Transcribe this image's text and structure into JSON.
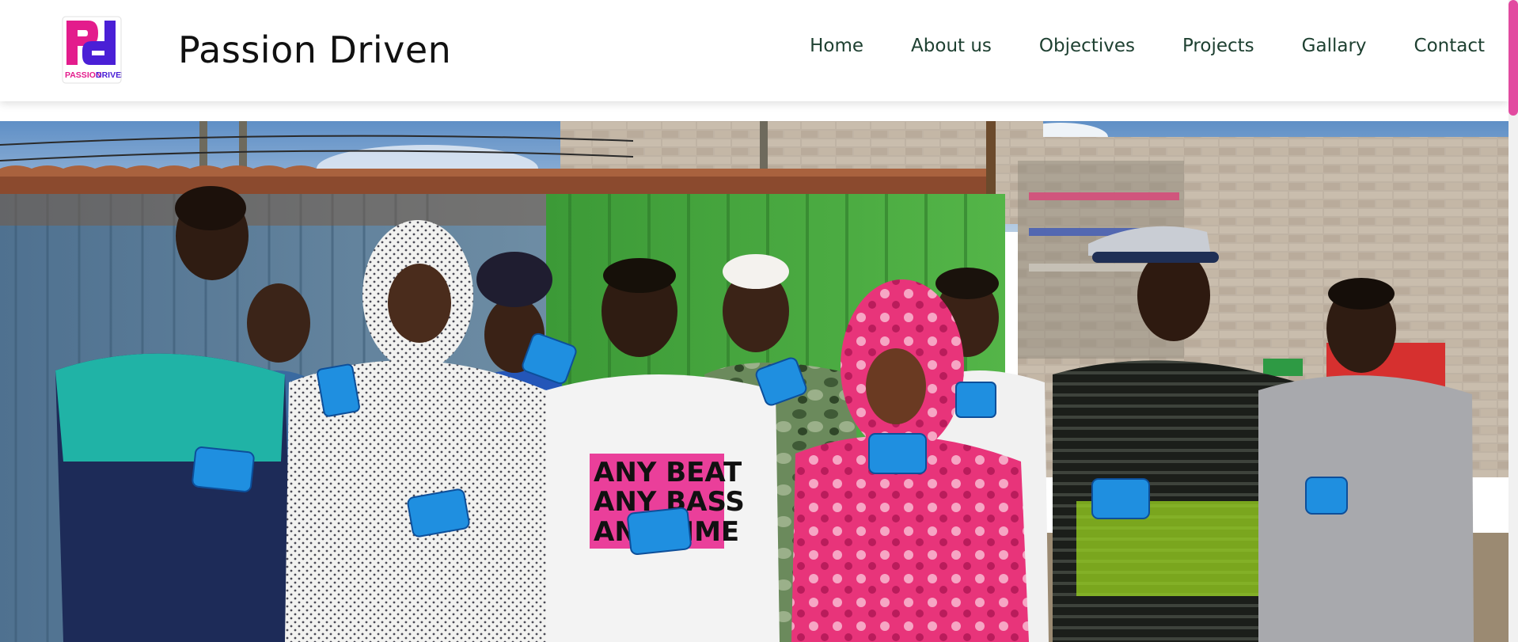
{
  "header": {
    "logo": {
      "text_left": "PASSION",
      "text_right": "DRIVEN",
      "icon": "pd-monogram-logo",
      "colors": {
        "pink": "#e31c8c",
        "purple": "#4a1fd6"
      }
    },
    "title": "Passion Driven",
    "nav": [
      {
        "label": "Home"
      },
      {
        "label": "About us"
      },
      {
        "label": "Objectives"
      },
      {
        "label": "Projects"
      },
      {
        "label": "Gallary"
      },
      {
        "label": "Contact"
      }
    ]
  },
  "hero": {
    "image": "group-photo-youth-holding-sanitary-pads",
    "shirt_text": [
      "ANY BEAT",
      "ANY BASS",
      "ANY TIME"
    ]
  },
  "colors": {
    "nav_text": "#1e4031",
    "scroll_accent": "#e24aa0"
  }
}
